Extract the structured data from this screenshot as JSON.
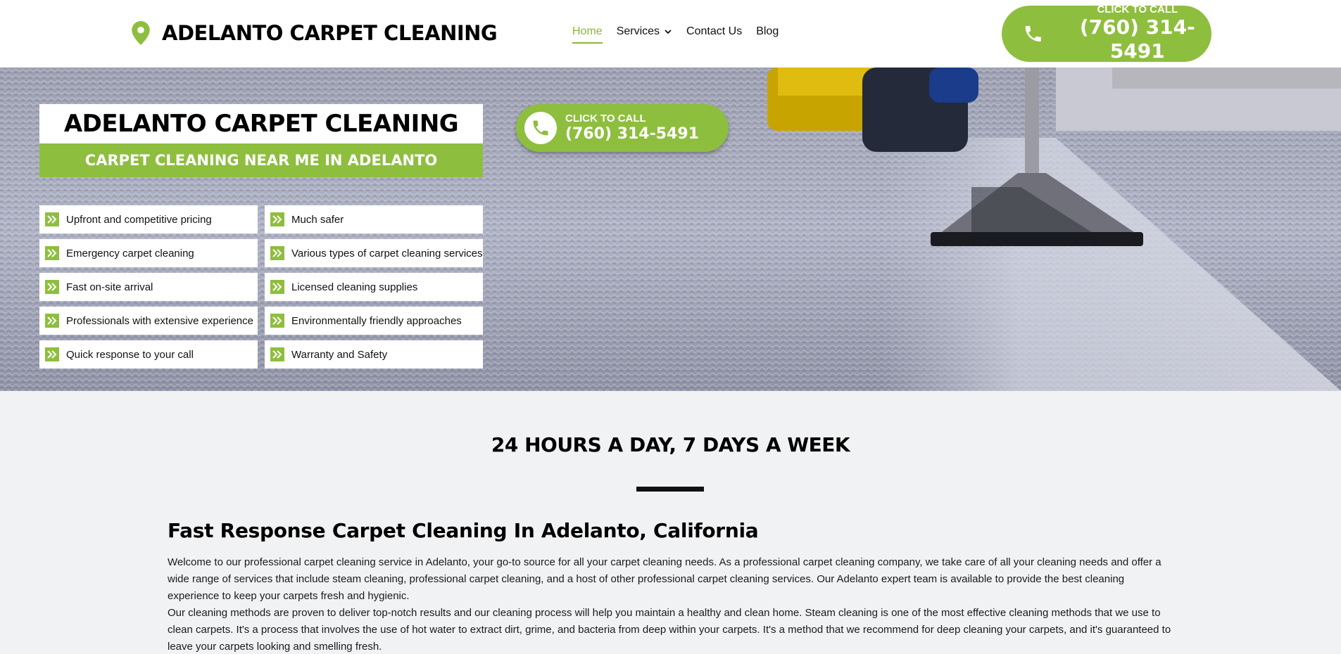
{
  "header": {
    "brand": "ADELANTO CARPET CLEANING",
    "nav": [
      {
        "label": "Home",
        "active": true
      },
      {
        "label": "Services",
        "dropdown": true
      },
      {
        "label": "Contact Us"
      },
      {
        "label": "Blog"
      }
    ],
    "call": {
      "small": "CLICK TO CALL",
      "number": "(760) 314-5491"
    }
  },
  "hero": {
    "title": "ADELANTO CARPET CLEANING",
    "subtitle": "CARPET CLEANING NEAR ME IN ADELANTO",
    "call": {
      "small": "CLICK TO CALL",
      "number": "(760) 314-5491"
    },
    "features_left": [
      "Upfront and competitive pricing",
      "Emergency carpet cleaning",
      "Fast on-site arrival",
      "Professionals with extensive experience",
      "Quick response to your call"
    ],
    "features_right": [
      "Much safer",
      "Various types of carpet cleaning services",
      "Licensed cleaning supplies",
      "Environmentally friendly approaches",
      "Warranty and Safety"
    ]
  },
  "content": {
    "hours": "24 HOURS A DAY, 7 DAYS A WEEK",
    "section_title": "Fast Response Carpet Cleaning In Adelanto, California",
    "paragraph1": "Welcome to our professional carpet cleaning service in Adelanto, your go-to source for all your carpet cleaning needs. As a professional carpet cleaning company, we take care of all your cleaning needs and offer a wide range of services that include steam cleaning, professional carpet cleaning, and a host of other professional carpet cleaning services. Our Adelanto expert team is available to provide the best cleaning experience to keep your carpets fresh and hygienic.",
    "paragraph2": "Our cleaning methods are proven to deliver top-notch results and our cleaning process will help you maintain a healthy and clean home. Steam cleaning is one of the most effective cleaning methods that we use to clean carpets. It's a process that involves the use of hot water to extract dirt, grime, and bacteria from deep within your carpets. It's a method that we recommend for deep cleaning your carpets, and it's guaranteed to leave your carpets looking and smelling fresh."
  },
  "colors": {
    "accent": "#8ebe3e",
    "text": "#111111",
    "background": "#f1f2f3"
  }
}
